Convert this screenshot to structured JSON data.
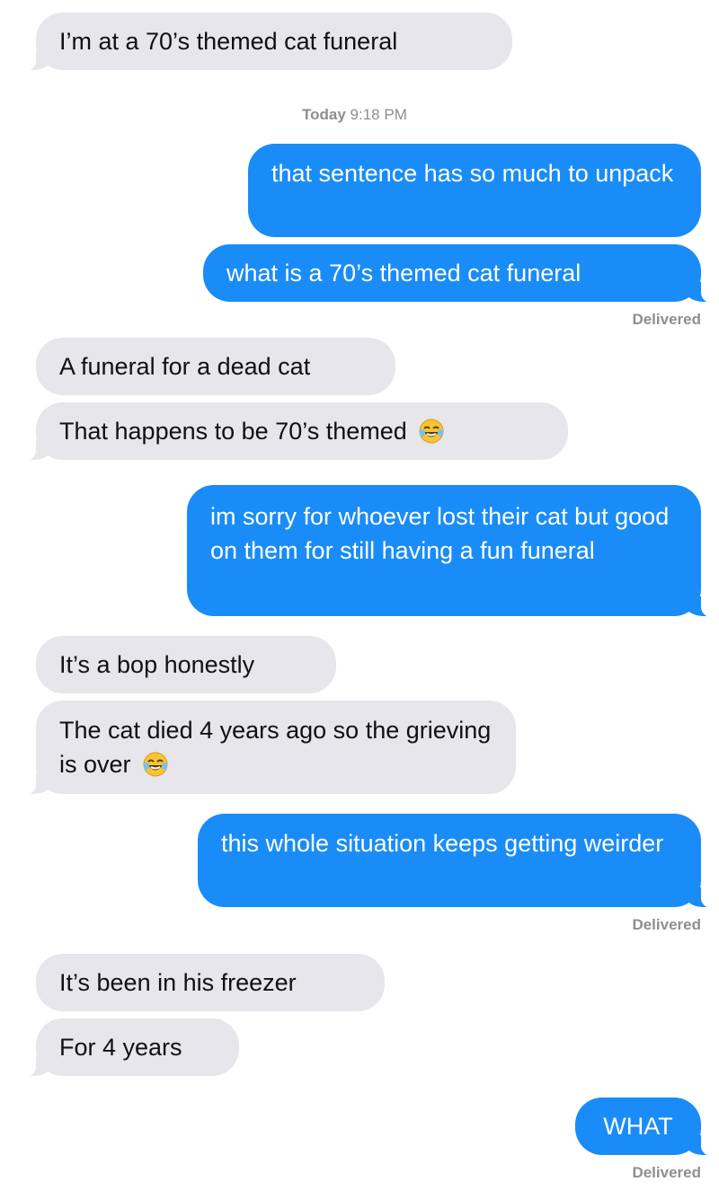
{
  "timestamp": {
    "day": "Today",
    "time": "9:18 PM"
  },
  "messages": [
    {
      "text": "I’m at a 70’s themed cat funeral"
    },
    {
      "text": "that sentence has so much to unpack"
    },
    {
      "text": "what is a 70’s themed cat funeral"
    },
    {
      "text": "A funeral for a dead cat"
    },
    {
      "text": "That happens to be 70’s themed",
      "emoji": "laughing-tears-emoji"
    },
    {
      "text": "im sorry for whoever lost their cat but good on them for still having a fun funeral"
    },
    {
      "text": "It’s a bop honestly"
    },
    {
      "text": "The cat died 4 years ago so the grieving is over",
      "emoji": "laughing-tears-emoji"
    },
    {
      "text": "this whole situation keeps getting weirder"
    },
    {
      "text": "It’s been in his freezer"
    },
    {
      "text": "For 4 years"
    },
    {
      "text": "WHAT"
    }
  ],
  "receipts": [
    "Delivered",
    "Delivered",
    "Delivered"
  ],
  "colors": {
    "sent": "#1a8cf7",
    "received": "#e6e6eb",
    "meta": "#8e8e93"
  }
}
